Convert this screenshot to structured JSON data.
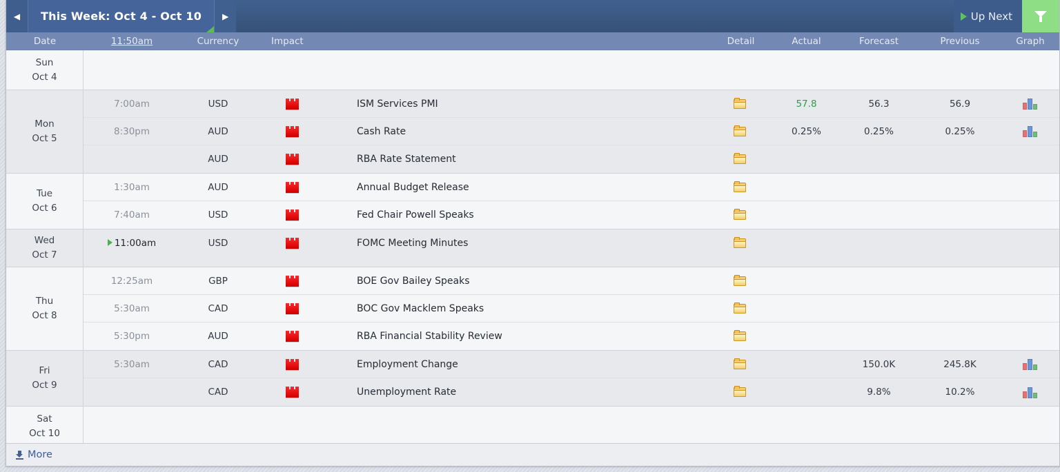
{
  "topbar": {
    "prev_label": "◀",
    "next_label": "▶",
    "week_title": "This Week: Oct 4 - Oct 10",
    "upnext_label": "Up Next",
    "filter_icon": "funnel-icon",
    "accent_green": "#8ede85",
    "bar_blue": "#3c5a8e"
  },
  "columns": {
    "date": "Date",
    "time": "11:50am",
    "currency": "Currency",
    "impact": "Impact",
    "detail": "Detail",
    "actual": "Actual",
    "forecast": "Forecast",
    "previous": "Previous",
    "graph": "Graph"
  },
  "days": [
    {
      "weekday": "Sun",
      "date": "Oct 4",
      "shade": "a",
      "events": []
    },
    {
      "weekday": "Mon",
      "date": "Oct 5",
      "shade": "b",
      "events": [
        {
          "time": "7:00am",
          "now": false,
          "currency": "USD",
          "impact": "high",
          "name": "ISM Services PMI",
          "detail": "detail-folder-doc",
          "actual": "57.8",
          "actual_state": "better",
          "forecast": "56.3",
          "previous": "56.9",
          "graph": true
        },
        {
          "time": "8:30pm",
          "now": false,
          "currency": "AUD",
          "impact": "high",
          "name": "Cash Rate",
          "detail": "detail-folder-doc",
          "actual": "0.25%",
          "actual_state": "neutral",
          "forecast": "0.25%",
          "previous": "0.25%",
          "graph": true
        },
        {
          "time": "",
          "now": false,
          "currency": "AUD",
          "impact": "high",
          "name": "RBA Rate Statement",
          "detail": "detail-folder-doc",
          "actual": "",
          "actual_state": "neutral",
          "forecast": "",
          "previous": "",
          "graph": false
        }
      ]
    },
    {
      "weekday": "Tue",
      "date": "Oct 6",
      "shade": "a",
      "events": [
        {
          "time": "1:30am",
          "now": false,
          "currency": "AUD",
          "impact": "high",
          "name": "Annual Budget Release",
          "detail": "detail-folder-doc",
          "actual": "",
          "actual_state": "neutral",
          "forecast": "",
          "previous": "",
          "graph": false
        },
        {
          "time": "7:40am",
          "now": false,
          "currency": "USD",
          "impact": "high",
          "name": "Fed Chair Powell Speaks",
          "detail": "detail-folder-doc",
          "actual": "",
          "actual_state": "neutral",
          "forecast": "",
          "previous": "",
          "graph": false
        }
      ]
    },
    {
      "weekday": "Wed",
      "date": "Oct 7",
      "shade": "b",
      "events": [
        {
          "time": "11:00am",
          "now": true,
          "currency": "USD",
          "impact": "high",
          "name": "FOMC Meeting Minutes",
          "detail": "detail-folder-doc",
          "actual": "",
          "actual_state": "neutral",
          "forecast": "",
          "previous": "",
          "graph": false
        }
      ]
    },
    {
      "weekday": "Thu",
      "date": "Oct 8",
      "shade": "a",
      "events": [
        {
          "time": "12:25am",
          "now": false,
          "currency": "GBP",
          "impact": "high",
          "name": "BOE Gov Bailey Speaks",
          "detail": "detail-folder-plain",
          "actual": "",
          "actual_state": "neutral",
          "forecast": "",
          "previous": "",
          "graph": false
        },
        {
          "time": "5:30am",
          "now": false,
          "currency": "CAD",
          "impact": "high",
          "name": "BOC Gov Macklem Speaks",
          "detail": "detail-folder-plain",
          "actual": "",
          "actual_state": "neutral",
          "forecast": "",
          "previous": "",
          "graph": false
        },
        {
          "time": "5:30pm",
          "now": false,
          "currency": "AUD",
          "impact": "high",
          "name": "RBA Financial Stability Review",
          "detail": "detail-folder-plain",
          "actual": "",
          "actual_state": "neutral",
          "forecast": "",
          "previous": "",
          "graph": false
        }
      ]
    },
    {
      "weekday": "Fri",
      "date": "Oct 9",
      "shade": "b",
      "events": [
        {
          "time": "5:30am",
          "now": false,
          "currency": "CAD",
          "impact": "high",
          "name": "Employment Change",
          "detail": "detail-folder-doc",
          "actual": "",
          "actual_state": "neutral",
          "forecast": "150.0K",
          "previous": "245.8K",
          "graph": true
        },
        {
          "time": "",
          "now": false,
          "currency": "CAD",
          "impact": "high",
          "name": "Unemployment Rate",
          "detail": "detail-folder-doc",
          "actual": "",
          "actual_state": "neutral",
          "forecast": "9.8%",
          "previous": "10.2%",
          "graph": true
        }
      ]
    },
    {
      "weekday": "Sat",
      "date": "Oct 10",
      "shade": "a",
      "events": []
    }
  ],
  "footer": {
    "more_label": "More",
    "more_icon": "download-icon"
  }
}
